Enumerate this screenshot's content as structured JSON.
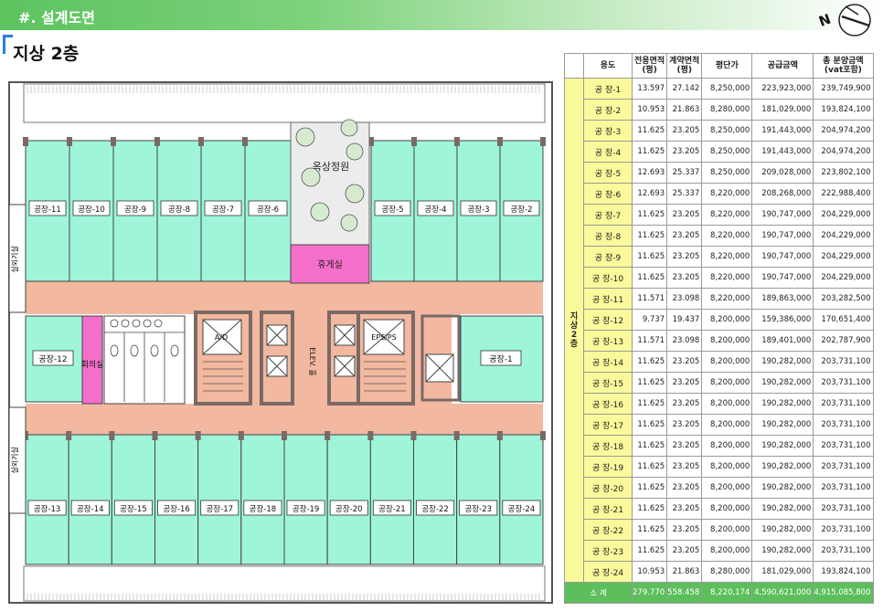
{
  "header": {
    "title": "#. 설계도면"
  },
  "floor_title": "지상 2층",
  "plan": {
    "rest_area": "휴게실",
    "roof_garden": "옥상정원",
    "meeting_room": "회의실",
    "elev_hall": "ELEV. 홀",
    "outdoor_unit": "실외기실",
    "room_top": [
      "공장-11",
      "공장-10",
      "공장-9",
      "공장-8",
      "공장-7",
      "공장-6",
      "공장-5",
      "공장-4",
      "공장-3",
      "공장-2"
    ],
    "room_mid_left": "공장-12",
    "room_mid_right": "공장-1",
    "room_bottom": [
      "공장-13",
      "공장-14",
      "공장-15",
      "공장-16",
      "공장-17",
      "공장-18",
      "공장-19",
      "공장-20",
      "공장-21",
      "공장-22",
      "공장-23",
      "공장-24"
    ],
    "colors": {
      "factory": "#9ef5da",
      "pink": "#f46fc9",
      "corridor": "#f2b8a0",
      "core": "#7a6a66"
    }
  },
  "table": {
    "headers": [
      "용도",
      "전용면적\n(평)",
      "계약면적\n(평)",
      "평단가",
      "공급금액",
      "총 분양금액\n(vat포함)"
    ],
    "floor_label": "지\n상\n2\n층",
    "rows": [
      [
        "공 장-1",
        "13.597",
        "27.142",
        "8,250,000",
        "223,923,000",
        "239,749,900"
      ],
      [
        "공 장-2",
        "10.953",
        "21.863",
        "8,280,000",
        "181,029,000",
        "193,824,100"
      ],
      [
        "공 장-3",
        "11.625",
        "23.205",
        "8,250,000",
        "191,443,000",
        "204,974,200"
      ],
      [
        "공 장-4",
        "11.625",
        "23.205",
        "8,250,000",
        "191,443,000",
        "204,974,200"
      ],
      [
        "공 장-5",
        "12.693",
        "25.337",
        "8,250,000",
        "209,028,000",
        "223,802,100"
      ],
      [
        "공 장-6",
        "12.693",
        "25.337",
        "8,220,000",
        "208,268,000",
        "222,988,400"
      ],
      [
        "공 장-7",
        "11.625",
        "23.205",
        "8,220,000",
        "190,747,000",
        "204,229,000"
      ],
      [
        "공 장-8",
        "11.625",
        "23.205",
        "8,220,000",
        "190,747,000",
        "204,229,000"
      ],
      [
        "공 장-9",
        "11.625",
        "23.205",
        "8,220,000",
        "190,747,000",
        "204,229,000"
      ],
      [
        "공 장-10",
        "11.625",
        "23.205",
        "8,220,000",
        "190,747,000",
        "204,229,000"
      ],
      [
        "공 장-11",
        "11.571",
        "23.098",
        "8,220,000",
        "189,863,000",
        "203,282,500"
      ],
      [
        "공 장-12",
        "9.737",
        "19.437",
        "8,200,000",
        "159,386,000",
        "170,651,400"
      ],
      [
        "공 장-13",
        "11.571",
        "23.098",
        "8,200,000",
        "189,401,000",
        "202,787,900"
      ],
      [
        "공 장-14",
        "11.625",
        "23.205",
        "8,200,000",
        "190,282,000",
        "203,731,100"
      ],
      [
        "공 장-15",
        "11.625",
        "23.205",
        "8,200,000",
        "190,282,000",
        "203,731,100"
      ],
      [
        "공 장-16",
        "11.625",
        "23.205",
        "8,200,000",
        "190,282,000",
        "203,731,100"
      ],
      [
        "공 장-17",
        "11.625",
        "23.205",
        "8,200,000",
        "190,282,000",
        "203,731,100"
      ],
      [
        "공 장-18",
        "11.625",
        "23.205",
        "8,200,000",
        "190,282,000",
        "203,731,100"
      ],
      [
        "공 장-19",
        "11.625",
        "23.205",
        "8,200,000",
        "190,282,000",
        "203,731,100"
      ],
      [
        "공 장-20",
        "11.625",
        "23.205",
        "8,200,000",
        "190,282,000",
        "203,731,100"
      ],
      [
        "공 장-21",
        "11.625",
        "23.205",
        "8,200,000",
        "190,282,000",
        "203,731,100"
      ],
      [
        "공 장-22",
        "11.625",
        "23.205",
        "8,200,000",
        "190,282,000",
        "203,731,100"
      ],
      [
        "공 장-23",
        "11.625",
        "23.205",
        "8,200,000",
        "190,282,000",
        "203,731,100"
      ],
      [
        "공 장-24",
        "10.953",
        "21.863",
        "8,280,000",
        "181,029,000",
        "193,824,100"
      ]
    ],
    "summary": [
      "소  계",
      "279.770",
      "558.458",
      "8,220,174",
      "4,590,621,000",
      "4,915,085,800"
    ]
  }
}
